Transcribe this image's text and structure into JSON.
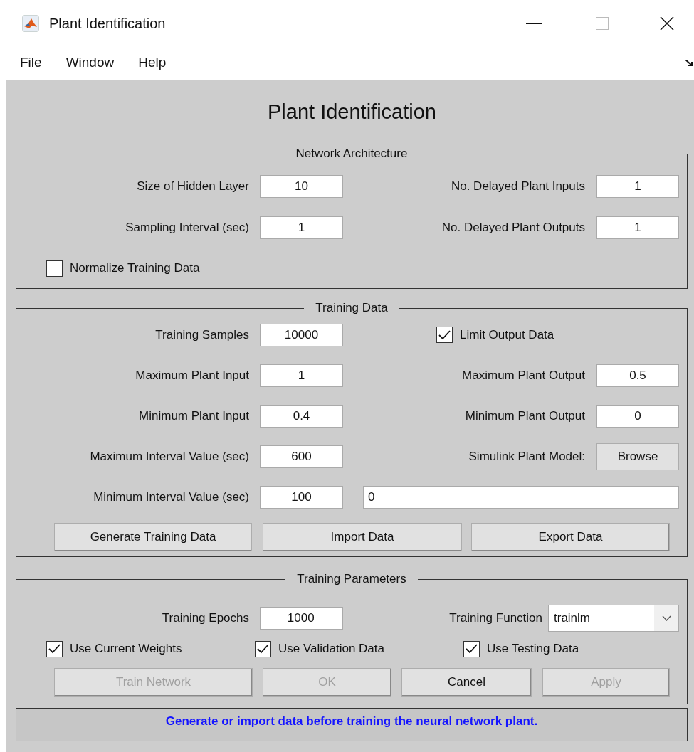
{
  "window": {
    "title": "Plant Identification"
  },
  "menu": [
    "File",
    "Window",
    "Help"
  ],
  "heading": "Plant Identification",
  "panels": [
    {
      "title": "Network Architecture",
      "rows": [
        {
          "left": {
            "kind": "field",
            "label": "Size of Hidden Layer",
            "value": "10"
          },
          "right": {
            "kind": "field",
            "label": "No. Delayed Plant Inputs",
            "value": "1"
          }
        },
        {
          "left": {
            "kind": "field",
            "label": "Sampling Interval (sec)",
            "value": "1"
          },
          "right": {
            "kind": "field",
            "label": "No. Delayed Plant Outputs",
            "value": "1"
          }
        },
        {
          "left": {
            "kind": "checkbox",
            "label": "Normalize Training Data",
            "checked": false
          }
        }
      ]
    },
    {
      "title": "Training Data",
      "rows": [
        {
          "left": {
            "kind": "field",
            "label": "Training Samples",
            "value": "10000"
          },
          "right": {
            "kind": "checkbox",
            "label": "Limit Output Data",
            "checked": true
          }
        },
        {
          "left": {
            "kind": "field",
            "label": "Maximum Plant Input",
            "value": "1"
          },
          "right": {
            "kind": "field",
            "label": "Maximum Plant Output",
            "value": "0.5"
          }
        },
        {
          "left": {
            "kind": "field",
            "label": "Minimum Plant Input",
            "value": "0.4"
          },
          "right": {
            "kind": "field",
            "label": "Minimum Plant Output",
            "value": "0"
          }
        },
        {
          "left": {
            "kind": "field",
            "label": "Maximum Interval Value (sec)",
            "value": "600"
          },
          "right": {
            "kind": "button",
            "label": "Simulink Plant Model:",
            "button": "Browse"
          }
        },
        {
          "left": {
            "kind": "field",
            "label": "Minimum Interval Value (sec)",
            "value": "100"
          },
          "right": {
            "kind": "wide_field",
            "value": "0"
          }
        }
      ],
      "buttons": [
        {
          "label": "Generate Training Data",
          "disabled": false
        },
        {
          "label": "Import Data",
          "disabled": false
        },
        {
          "label": "Export Data",
          "disabled": false
        }
      ]
    },
    {
      "title": "Training Parameters",
      "rows": [
        {
          "left": {
            "kind": "field",
            "label": "Training Epochs",
            "value": "1000",
            "focused": true
          },
          "right": {
            "kind": "dropdown",
            "label": "Training Function",
            "value": "trainlm"
          }
        }
      ],
      "checks": [
        {
          "label": "Use Current Weights",
          "checked": true
        },
        {
          "label": "Use Validation Data",
          "checked": true
        },
        {
          "label": "Use Testing Data",
          "checked": true
        }
      ],
      "buttons": [
        {
          "label": "Train Network",
          "disabled": true
        },
        {
          "label": "OK",
          "disabled": true
        },
        {
          "label": "Cancel",
          "disabled": false
        },
        {
          "label": "Apply",
          "disabled": true
        }
      ]
    }
  ],
  "status": "Generate or import data before training the neural network plant."
}
